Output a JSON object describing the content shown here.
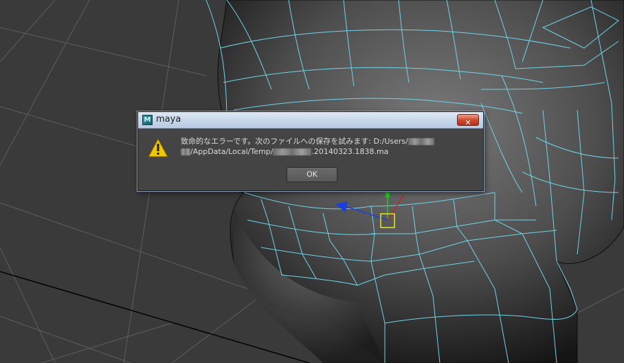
{
  "viewport": {
    "background_color": "#3a3a3a",
    "grid_color": "#5e5e5e",
    "wireframe_color": "#6fd6ea",
    "mesh_color": "#4a4a4a",
    "manipulator": {
      "x_axis_color": "#d02020",
      "y_axis_color": "#20d020",
      "z_axis_color": "#1a3fe0",
      "center_color": "#e8e820"
    }
  },
  "dialog": {
    "app_icon_letter": "M",
    "title": "maya",
    "close_icon": "close-x-icon",
    "close_symbol": "✕",
    "warning_icon": "warning-triangle-icon",
    "message_line1": "致命的なエラーです。次のファイルへの保存を試みます: D:/Users/",
    "message_line2_path": "/AppData/Local/Temp/",
    "message_line2_suffix": ".20140323.1838.ma",
    "ok_label": "OK"
  }
}
